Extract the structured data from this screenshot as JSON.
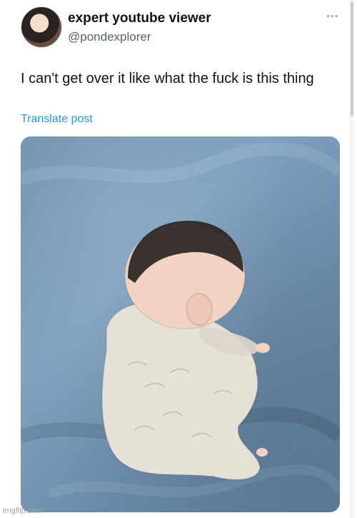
{
  "tweet": {
    "display_name": "expert youtube viewer",
    "handle": "@pondexplorer",
    "more_icon": "more-horizontal-icon",
    "text": "I can't get over it like what the fuck is this thing",
    "translate_label": "Translate post"
  },
  "media": {
    "description_icon": "photo-baby-sleeping"
  },
  "watermark": "imgflip.com",
  "colors": {
    "link": "#1d9bf0",
    "handle": "#536471",
    "text": "#0f1419"
  }
}
